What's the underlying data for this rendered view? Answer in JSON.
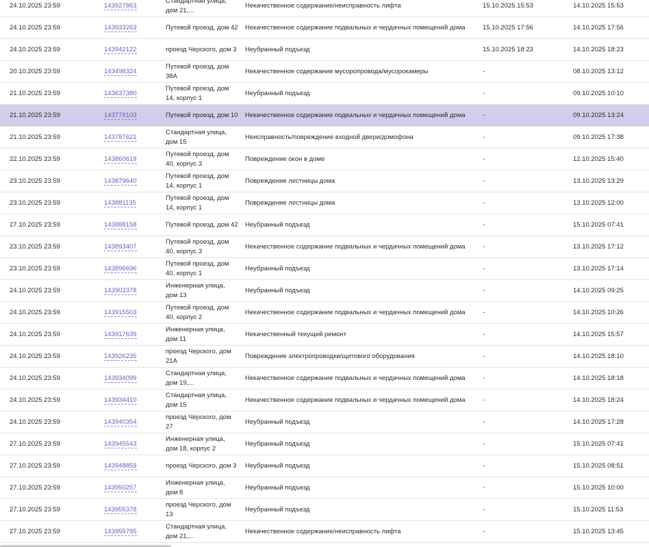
{
  "rows": [
    {
      "deadline": "24.10.2025 23:59",
      "id": "143927863",
      "address": "Стандартная улица, дом 21,...",
      "description": "Некачественное содержание/неисправность лифта",
      "completed": "15.10.2025 15:53",
      "created": "14.10.2025 15:53",
      "selected": false
    },
    {
      "deadline": "24.10.2025 23:59",
      "id": "143933263",
      "address": "Путевой проезд, дом 42",
      "description": "Некачественное содержание подвальных и чердачных помещений дома",
      "completed": "15.10.2025 17:56",
      "created": "14.10.2025 17:56",
      "selected": false
    },
    {
      "deadline": "24.10.2025 23:59",
      "id": "143942122",
      "address": "проезд Черского, дом 3",
      "description": "Неубранный подъезд",
      "completed": "15.10.2025 18:23",
      "created": "14.10.2025 18:23",
      "selected": false
    },
    {
      "deadline": "20.10.2025 23:59",
      "id": "143498324",
      "address": "Путевой проезд, дом 38А",
      "description": "Некачественное содержание мусоропровода/мусорокамеры",
      "completed": "-",
      "created": "08.10.2025 13:12",
      "selected": false
    },
    {
      "deadline": "21.10.2025 23:59",
      "id": "143637380",
      "address": "Путевой проезд, дом 14, корпус 1",
      "description": "Неубранный подъезд",
      "completed": "-",
      "created": "09.10.2025 10:10",
      "selected": false
    },
    {
      "deadline": "21.10.2025 23:59",
      "id": "143778103",
      "address": "Путевой проезд, дом 10",
      "description": "Некачественное содержание подвальных и чердачных помещений дома",
      "completed": "-",
      "created": "09.10.2025 13:24",
      "selected": true
    },
    {
      "deadline": "21.10.2025 23:59",
      "id": "143787621",
      "address": "Стандартная улица, дом 15",
      "description": "Неисправность/повреждение входной двери/домофона",
      "completed": "-",
      "created": "09.10.2025 17:38",
      "selected": false
    },
    {
      "deadline": "22.10.2025 23:59",
      "id": "143860619",
      "address": "Путевой проезд, дом 40, корпус 3",
      "description": "Повреждение окон в доме",
      "completed": "-",
      "created": "12.10.2025 15:40",
      "selected": false
    },
    {
      "deadline": "23.10.2025 23:59",
      "id": "143879640",
      "address": "Путевой проезд, дом 14, корпус 1",
      "description": "Повреждение лестницы дома",
      "completed": "-",
      "created": "13.10.2025 13:29",
      "selected": false
    },
    {
      "deadline": "23.10.2025 23:59",
      "id": "143881135",
      "address": "Путевой проезд, дом 14, корпус 1",
      "description": "Повреждение лестницы дома",
      "completed": "-",
      "created": "13.10.2025 12:00",
      "selected": false
    },
    {
      "deadline": "27.10.2025 23:59",
      "id": "143888158",
      "address": "Путевой проезд, дом 42",
      "description": "Неубранный подъезд",
      "completed": "-",
      "created": "15.10.2025 07:41",
      "selected": false
    },
    {
      "deadline": "23.10.2025 23:59",
      "id": "143893407",
      "address": "Путевой проезд, дом 40, корпус 3",
      "description": "Некачественное содержание подвальных и чердачных помещений дома",
      "completed": "-",
      "created": "13.10.2025 17:12",
      "selected": false
    },
    {
      "deadline": "23.10.2025 23:59",
      "id": "143896696",
      "address": "Путевой проезд, дом 40, корпус 1",
      "description": "Неубранный подъезд",
      "completed": "-",
      "created": "13.10.2025 17:14",
      "selected": false
    },
    {
      "deadline": "24.10.2025 23:59",
      "id": "143903378",
      "address": "Инженерная улица, дом 13",
      "description": "Неубранный подъезд",
      "completed": "-",
      "created": "14.10.2025 09:25",
      "selected": false
    },
    {
      "deadline": "24.10.2025 23:59",
      "id": "143915503",
      "address": "Путевой проезд, дом 40, корпус 2",
      "description": "Некачественное содержание подвальных и чердачных помещений дома",
      "completed": "-",
      "created": "14.10.2025 10:26",
      "selected": false
    },
    {
      "deadline": "24.10.2025 23:59",
      "id": "143917639",
      "address": "Инженерная улица, дом 11",
      "description": "Некачественный текущий ремонт",
      "completed": "-",
      "created": "14.10.2025 15:57",
      "selected": false
    },
    {
      "deadline": "24.10.2025 23:59",
      "id": "143926235",
      "address": "проезд Черского, дом 21А",
      "description": "Повреждение электропроводки/щитового оборудования",
      "completed": "-",
      "created": "14.10.2025 18:10",
      "selected": false
    },
    {
      "deadline": "24.10.2025 23:59",
      "id": "143934099",
      "address": "Стандартная улица, дом 19,...",
      "description": "Некачественное содержание подвальных и чердачных помещений дома",
      "completed": "-",
      "created": "14.10.2025 18:18",
      "selected": false
    },
    {
      "deadline": "24.10.2025 23:59",
      "id": "143934410",
      "address": "Стандартная улица, дом 15",
      "description": "Некачественное содержание подвальных и чердачных помещений дома",
      "completed": "-",
      "created": "14.10.2025 18:24",
      "selected": false
    },
    {
      "deadline": "24.10.2025 23:59",
      "id": "143940354",
      "address": "проезд Черского, дом 27",
      "description": "Неубранный подъезд",
      "completed": "-",
      "created": "14.10.2025 17:28",
      "selected": false
    },
    {
      "deadline": "27.10.2025 23:59",
      "id": "143945543",
      "address": "Инженерная улица, дом 18, корпус 2",
      "description": "Неубранный подъезд",
      "completed": "-",
      "created": "15.10.2025 07:41",
      "selected": false
    },
    {
      "deadline": "27.10.2025 23:59",
      "id": "143948859",
      "address": "проезд Черского, дом 3",
      "description": "Неубранный подъезд",
      "completed": "-",
      "created": "15.10.2025 08:51",
      "selected": false
    },
    {
      "deadline": "27.10.2025 23:59",
      "id": "143950257",
      "address": "Инженерная улица, дом 8",
      "description": "Неубранный подъезд",
      "completed": "-",
      "created": "15.10.2025 10:00",
      "selected": false
    },
    {
      "deadline": "27.10.2025 23:59",
      "id": "143955378",
      "address": "проезд Черского, дом 13",
      "description": "Неубранный подъезд",
      "completed": "-",
      "created": "15.10.2025 11:53",
      "selected": false
    },
    {
      "deadline": "27.10.2025 23:59",
      "id": "143955785",
      "address": "Стандартная улица, дом 21,...",
      "description": "Некачественное содержание/неисправность лифта",
      "completed": "-",
      "created": "15.10.2025 13:45",
      "selected": false
    }
  ]
}
